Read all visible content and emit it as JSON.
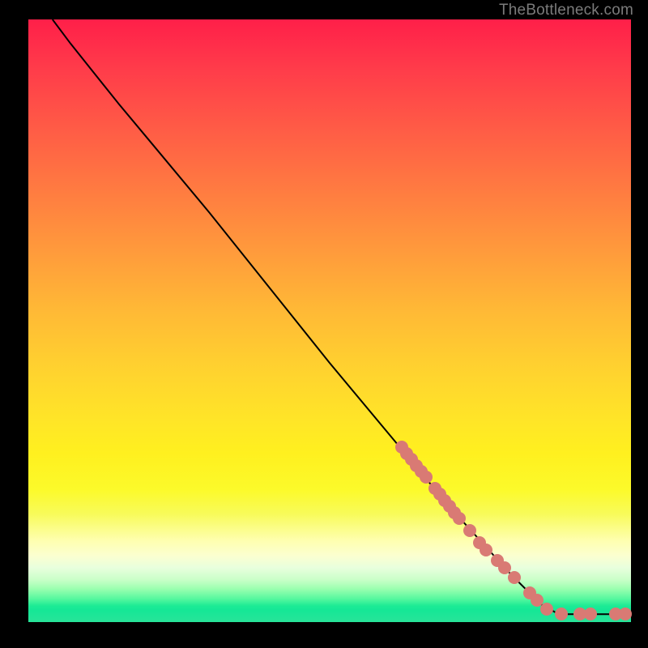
{
  "attribution": "TheBottleneck.com",
  "chart_data": {
    "type": "line",
    "title": "",
    "xlabel": "",
    "ylabel": "",
    "xlim": [
      0,
      100
    ],
    "ylim": [
      0,
      100
    ],
    "grid": false,
    "legend": false,
    "curve": [
      {
        "x": 4.0,
        "y": 100.0
      },
      {
        "x": 7.0,
        "y": 96.0
      },
      {
        "x": 11.0,
        "y": 91.0
      },
      {
        "x": 15.0,
        "y": 86.0
      },
      {
        "x": 20.0,
        "y": 80.0
      },
      {
        "x": 30.0,
        "y": 68.0
      },
      {
        "x": 40.0,
        "y": 55.5
      },
      {
        "x": 50.0,
        "y": 43.0
      },
      {
        "x": 60.0,
        "y": 31.0
      },
      {
        "x": 70.0,
        "y": 19.0
      },
      {
        "x": 80.0,
        "y": 8.0
      },
      {
        "x": 85.0,
        "y": 3.0
      },
      {
        "x": 88.0,
        "y": 1.3
      },
      {
        "x": 92.0,
        "y": 1.3
      },
      {
        "x": 100.0,
        "y": 1.3
      }
    ],
    "markers": [
      {
        "x": 62.0,
        "y": 29.0
      },
      {
        "x": 62.8,
        "y": 28.0
      },
      {
        "x": 63.6,
        "y": 27.0
      },
      {
        "x": 64.4,
        "y": 26.0
      },
      {
        "x": 65.2,
        "y": 25.0
      },
      {
        "x": 66.0,
        "y": 24.0
      },
      {
        "x": 67.5,
        "y": 22.2
      },
      {
        "x": 68.3,
        "y": 21.2
      },
      {
        "x": 69.1,
        "y": 20.2
      },
      {
        "x": 69.9,
        "y": 19.2
      },
      {
        "x": 70.7,
        "y": 18.2
      },
      {
        "x": 71.5,
        "y": 17.2
      },
      {
        "x": 73.2,
        "y": 15.2
      },
      {
        "x": 74.8,
        "y": 13.2
      },
      {
        "x": 76.0,
        "y": 12.0
      },
      {
        "x": 77.8,
        "y": 10.2
      },
      {
        "x": 79.0,
        "y": 9.0
      },
      {
        "x": 80.6,
        "y": 7.4
      },
      {
        "x": 83.2,
        "y": 4.8
      },
      {
        "x": 84.4,
        "y": 3.6
      },
      {
        "x": 86.0,
        "y": 2.2
      },
      {
        "x": 88.5,
        "y": 1.3
      },
      {
        "x": 91.5,
        "y": 1.3
      },
      {
        "x": 93.3,
        "y": 1.3
      },
      {
        "x": 97.5,
        "y": 1.3
      },
      {
        "x": 99.0,
        "y": 1.3
      }
    ],
    "marker_color": "#d97a74",
    "line_color": "#000000"
  }
}
